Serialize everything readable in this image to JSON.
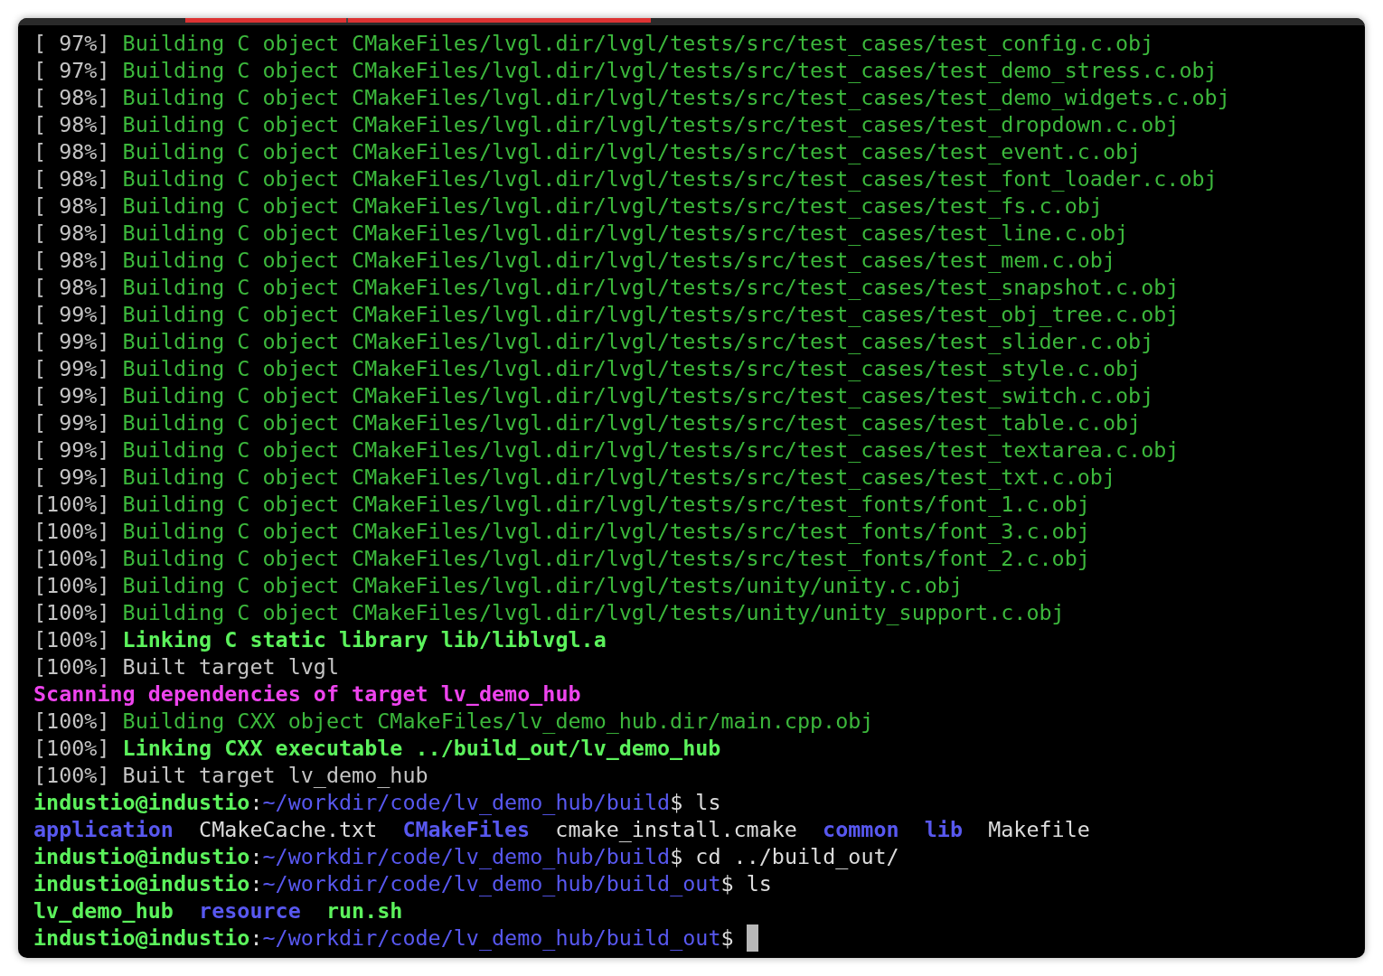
{
  "terminal": {
    "lines": [
      {
        "kind": "log",
        "segments": [
          {
            "text": "[ 97%]",
            "kind": "dim"
          },
          {
            "text": "Building C object CMakeFiles/lvgl.dir/lvgl/tests/src/test_cases/test_config.c.obj",
            "kind": "build"
          }
        ]
      },
      {
        "kind": "log",
        "segments": [
          {
            "text": "[ 97%]",
            "kind": "dim"
          },
          {
            "text": "Building C object CMakeFiles/lvgl.dir/lvgl/tests/src/test_cases/test_demo_stress.c.obj",
            "kind": "build"
          }
        ]
      },
      {
        "kind": "log",
        "segments": [
          {
            "text": "[ 98%]",
            "kind": "dim"
          },
          {
            "text": "Building C object CMakeFiles/lvgl.dir/lvgl/tests/src/test_cases/test_demo_widgets.c.obj",
            "kind": "build"
          }
        ]
      },
      {
        "kind": "log",
        "segments": [
          {
            "text": "[ 98%]",
            "kind": "dim"
          },
          {
            "text": "Building C object CMakeFiles/lvgl.dir/lvgl/tests/src/test_cases/test_dropdown.c.obj",
            "kind": "build"
          }
        ]
      },
      {
        "kind": "log",
        "segments": [
          {
            "text": "[ 98%]",
            "kind": "dim"
          },
          {
            "text": "Building C object CMakeFiles/lvgl.dir/lvgl/tests/src/test_cases/test_event.c.obj",
            "kind": "build"
          }
        ]
      },
      {
        "kind": "log",
        "segments": [
          {
            "text": "[ 98%]",
            "kind": "dim"
          },
          {
            "text": "Building C object CMakeFiles/lvgl.dir/lvgl/tests/src/test_cases/test_font_loader.c.obj",
            "kind": "build"
          }
        ]
      },
      {
        "kind": "log",
        "segments": [
          {
            "text": "[ 98%]",
            "kind": "dim"
          },
          {
            "text": "Building C object CMakeFiles/lvgl.dir/lvgl/tests/src/test_cases/test_fs.c.obj",
            "kind": "build"
          }
        ]
      },
      {
        "kind": "log",
        "segments": [
          {
            "text": "[ 98%]",
            "kind": "dim"
          },
          {
            "text": "Building C object CMakeFiles/lvgl.dir/lvgl/tests/src/test_cases/test_line.c.obj",
            "kind": "build"
          }
        ]
      },
      {
        "kind": "log",
        "segments": [
          {
            "text": "[ 98%]",
            "kind": "dim"
          },
          {
            "text": "Building C object CMakeFiles/lvgl.dir/lvgl/tests/src/test_cases/test_mem.c.obj",
            "kind": "build"
          }
        ]
      },
      {
        "kind": "log",
        "segments": [
          {
            "text": "[ 98%]",
            "kind": "dim"
          },
          {
            "text": "Building C object CMakeFiles/lvgl.dir/lvgl/tests/src/test_cases/test_snapshot.c.obj",
            "kind": "build"
          }
        ]
      },
      {
        "kind": "log",
        "segments": [
          {
            "text": "[ 99%]",
            "kind": "dim"
          },
          {
            "text": "Building C object CMakeFiles/lvgl.dir/lvgl/tests/src/test_cases/test_obj_tree.c.obj",
            "kind": "build"
          }
        ]
      },
      {
        "kind": "log",
        "segments": [
          {
            "text": "[ 99%]",
            "kind": "dim"
          },
          {
            "text": "Building C object CMakeFiles/lvgl.dir/lvgl/tests/src/test_cases/test_slider.c.obj",
            "kind": "build"
          }
        ]
      },
      {
        "kind": "log",
        "segments": [
          {
            "text": "[ 99%]",
            "kind": "dim"
          },
          {
            "text": "Building C object CMakeFiles/lvgl.dir/lvgl/tests/src/test_cases/test_style.c.obj",
            "kind": "build"
          }
        ]
      },
      {
        "kind": "log",
        "segments": [
          {
            "text": "[ 99%]",
            "kind": "dim"
          },
          {
            "text": "Building C object CMakeFiles/lvgl.dir/lvgl/tests/src/test_cases/test_switch.c.obj",
            "kind": "build"
          }
        ]
      },
      {
        "kind": "log",
        "segments": [
          {
            "text": "[ 99%]",
            "kind": "dim"
          },
          {
            "text": "Building C object CMakeFiles/lvgl.dir/lvgl/tests/src/test_cases/test_table.c.obj",
            "kind": "build"
          }
        ]
      },
      {
        "kind": "log",
        "segments": [
          {
            "text": "[ 99%]",
            "kind": "dim"
          },
          {
            "text": "Building C object CMakeFiles/lvgl.dir/lvgl/tests/src/test_cases/test_textarea.c.obj",
            "kind": "build"
          }
        ]
      },
      {
        "kind": "log",
        "segments": [
          {
            "text": "[ 99%]",
            "kind": "dim"
          },
          {
            "text": "Building C object CMakeFiles/lvgl.dir/lvgl/tests/src/test_cases/test_txt.c.obj",
            "kind": "build"
          }
        ]
      },
      {
        "kind": "log",
        "segments": [
          {
            "text": "[100%]",
            "kind": "dim"
          },
          {
            "text": "Building C object CMakeFiles/lvgl.dir/lvgl/tests/src/test_fonts/font_1.c.obj",
            "kind": "build"
          }
        ]
      },
      {
        "kind": "log",
        "segments": [
          {
            "text": "[100%]",
            "kind": "dim"
          },
          {
            "text": "Building C object CMakeFiles/lvgl.dir/lvgl/tests/src/test_fonts/font_3.c.obj",
            "kind": "build"
          }
        ]
      },
      {
        "kind": "log",
        "segments": [
          {
            "text": "[100%]",
            "kind": "dim"
          },
          {
            "text": "Building C object CMakeFiles/lvgl.dir/lvgl/tests/src/test_fonts/font_2.c.obj",
            "kind": "build"
          }
        ]
      },
      {
        "kind": "log",
        "segments": [
          {
            "text": "[100%]",
            "kind": "dim"
          },
          {
            "text": "Building C object CMakeFiles/lvgl.dir/lvgl/tests/unity/unity.c.obj",
            "kind": "build"
          }
        ]
      },
      {
        "kind": "log",
        "segments": [
          {
            "text": "[100%]",
            "kind": "dim"
          },
          {
            "text": "Building C object CMakeFiles/lvgl.dir/lvgl/tests/unity/unity_support.c.obj",
            "kind": "build"
          }
        ]
      },
      {
        "kind": "log",
        "segments": [
          {
            "text": "[100%]",
            "kind": "dim"
          },
          {
            "text": "Linking C static library lib/liblvgl.a",
            "kind": "link"
          }
        ]
      },
      {
        "kind": "log",
        "segments": [
          {
            "text": "[100%]",
            "kind": "dim"
          },
          {
            "text": "Built target lvgl",
            "kind": "dim"
          }
        ]
      },
      {
        "kind": "log",
        "segments": [
          {
            "text": "Scanning dependencies of target lv_demo_hub",
            "kind": "scan"
          }
        ]
      },
      {
        "kind": "log",
        "segments": [
          {
            "text": "[100%]",
            "kind": "dim"
          },
          {
            "text": "Building CXX object CMakeFiles/lv_demo_hub.dir/main.cpp.obj",
            "kind": "build"
          }
        ]
      },
      {
        "kind": "log",
        "segments": [
          {
            "text": "[100%]",
            "kind": "dim"
          },
          {
            "text": "Linking CXX executable ../build_out/lv_demo_hub",
            "kind": "link"
          }
        ]
      },
      {
        "kind": "log",
        "segments": [
          {
            "text": "[100%]",
            "kind": "dim"
          },
          {
            "text": "Built target lv_demo_hub",
            "kind": "dim"
          }
        ]
      },
      {
        "kind": "prompt",
        "segments": [
          {
            "text": "industio@industio",
            "kind": "user"
          },
          {
            "text": ":",
            "kind": "plain"
          },
          {
            "text": "~/workdir/code/lv_demo_hub/build",
            "kind": "path"
          },
          {
            "text": "$ ls",
            "kind": "plain"
          }
        ]
      },
      {
        "kind": "listing",
        "segments": [
          {
            "text": "application",
            "kind": "dir"
          },
          {
            "text": "CMakeCache.txt",
            "kind": "plain"
          },
          {
            "text": "CMakeFiles",
            "kind": "dir"
          },
          {
            "text": "cmake_install.cmake",
            "kind": "plain"
          },
          {
            "text": "common",
            "kind": "dir"
          },
          {
            "text": "lib",
            "kind": "dir"
          },
          {
            "text": "Makefile",
            "kind": "plain"
          }
        ]
      },
      {
        "kind": "prompt",
        "segments": [
          {
            "text": "industio@industio",
            "kind": "user"
          },
          {
            "text": ":",
            "kind": "plain"
          },
          {
            "text": "~/workdir/code/lv_demo_hub/build",
            "kind": "path"
          },
          {
            "text": "$ cd ../build_out/",
            "kind": "plain"
          }
        ]
      },
      {
        "kind": "prompt",
        "segments": [
          {
            "text": "industio@industio",
            "kind": "user"
          },
          {
            "text": ":",
            "kind": "plain"
          },
          {
            "text": "~/workdir/code/lv_demo_hub/build_out",
            "kind": "path"
          },
          {
            "text": "$ ls",
            "kind": "plain"
          }
        ]
      },
      {
        "kind": "listing",
        "segments": [
          {
            "text": "lv_demo_hub",
            "kind": "exec"
          },
          {
            "text": "resource",
            "kind": "dir"
          },
          {
            "text": "run.sh",
            "kind": "exec"
          }
        ]
      },
      {
        "kind": "prompt",
        "cursor": true,
        "segments": [
          {
            "text": "industio@industio",
            "kind": "user"
          },
          {
            "text": ":",
            "kind": "plain"
          },
          {
            "text": "~/workdir/code/lv_demo_hub/build_out",
            "kind": "path"
          },
          {
            "text": "$",
            "kind": "plain"
          }
        ]
      }
    ]
  }
}
